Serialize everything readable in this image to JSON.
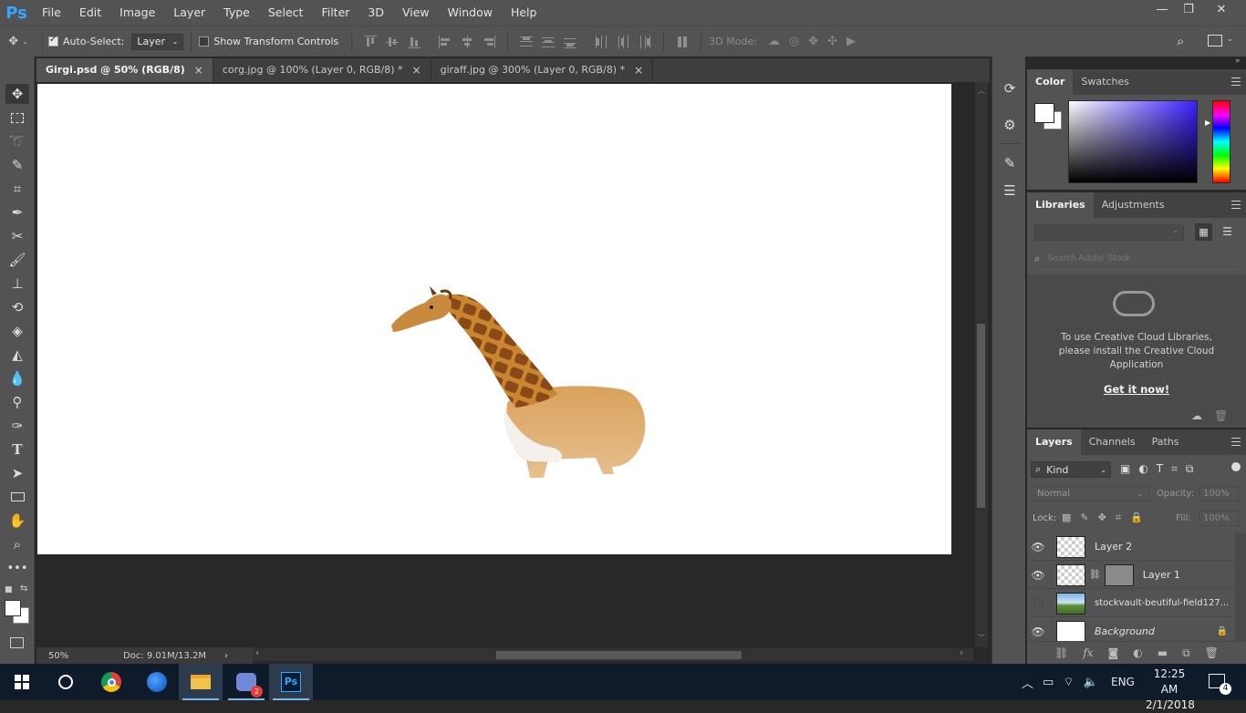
{
  "app": {
    "logo": "Ps"
  },
  "menu": [
    "File",
    "Edit",
    "Image",
    "Layer",
    "Type",
    "Select",
    "Filter",
    "3D",
    "View",
    "Window",
    "Help"
  ],
  "window_controls": {
    "minimize": "—",
    "restore": "❐",
    "close": "✕"
  },
  "options_bar": {
    "auto_select_label": "Auto-Select:",
    "auto_select_checked": true,
    "auto_select_value": "Layer",
    "show_transform_label": "Show Transform Controls",
    "show_transform_checked": false,
    "mode_3d_label": "3D Mode:"
  },
  "tabs": [
    {
      "label": "Girgi.psd @ 50% (RGB/8)",
      "active": true
    },
    {
      "label": "corg.jpg @ 100% (Layer 0, RGB/8) *",
      "active": false
    },
    {
      "label": "giraff.jpg @ 300% (Layer 0, RGB/8) *",
      "active": false
    }
  ],
  "tab_close": "×",
  "status": {
    "zoom": "50%",
    "doc": "Doc: 9.01M/13.2M"
  },
  "color_panel": {
    "tabs": [
      "Color",
      "Swatches"
    ]
  },
  "libraries_panel": {
    "tabs": [
      "Libraries",
      "Adjustments"
    ],
    "search_placeholder": "Search Adobe Stock",
    "message": "To use Creative Cloud Libraries, please install the Creative Cloud Application",
    "link": "Get it now!"
  },
  "layers_panel": {
    "tabs": [
      "Layers",
      "Channels",
      "Paths"
    ],
    "kind_label": "Kind",
    "blend_mode": "Normal",
    "opacity_label": "Opacity:",
    "opacity_value": "100%",
    "lock_label": "Lock:",
    "fill_label": "Fill:",
    "fill_value": "100%",
    "layers": [
      {
        "name": "Layer 2",
        "visible": true
      },
      {
        "name": "Layer 1",
        "visible": true
      },
      {
        "name": "stockvault-beutiful-field127...",
        "visible": false
      },
      {
        "name": "Background",
        "visible": true
      }
    ]
  },
  "taskbar": {
    "clock_time": "12:25 AM",
    "clock_date": "2/1/2018",
    "language": "ENG",
    "notifications": "4",
    "badge": "2"
  }
}
